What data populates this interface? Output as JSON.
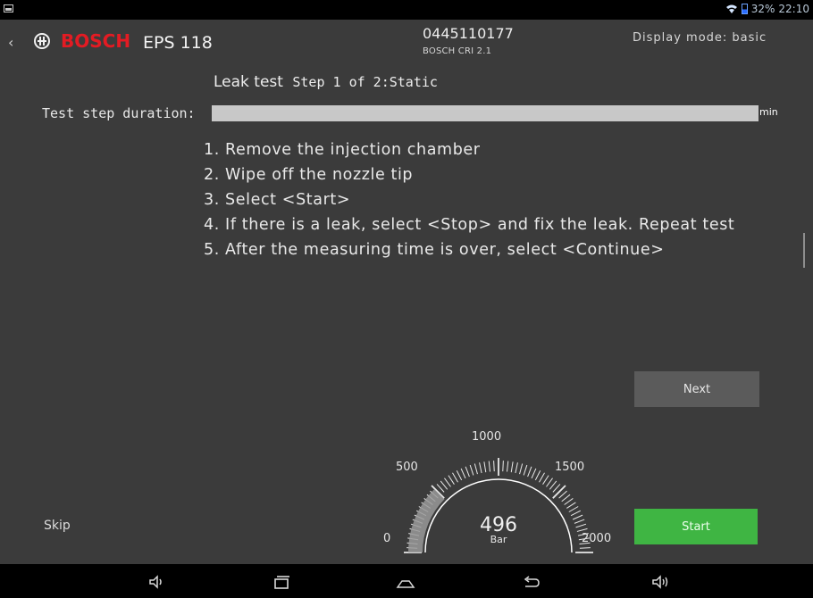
{
  "status": {
    "battery": "32%",
    "time": "22:10"
  },
  "header": {
    "brand": "BOSCH",
    "product": "EPS 118",
    "part_number": "0445110177",
    "part_sub": "BOSCH CRI 2.1",
    "display_mode": "Display mode: basic"
  },
  "main": {
    "title": "Leak test",
    "step": "Step 1 of 2:Static",
    "duration_label": "Test step duration:",
    "duration_unit": "min",
    "instructions": [
      "1. Remove the injection chamber",
      "2. Wipe off the nozzle tip",
      "3. Select <Start>",
      "4. If there is a leak, select <Stop> and fix the leak. Repeat test",
      "5. After the measuring time is over, select <Continue>"
    ]
  },
  "buttons": {
    "next": "Next",
    "start": "Start",
    "skip": "Skip"
  },
  "gauge": {
    "value": "496",
    "unit": "Bar",
    "min": 0,
    "max": 2000,
    "current": 496,
    "tick_labels": [
      "0",
      "500",
      "1000",
      "1500",
      "2000"
    ]
  },
  "colors": {
    "background": "#3b3b3b",
    "brand_red": "#e31b23",
    "start_green": "#3fb543",
    "button_gray": "#5b5b5b"
  },
  "icons": [
    "back-icon",
    "bosch-logo-icon",
    "wifi-icon",
    "battery-icon",
    "volume-down-icon",
    "recent-apps-icon",
    "home-icon",
    "back-nav-icon",
    "volume-up-icon"
  ]
}
